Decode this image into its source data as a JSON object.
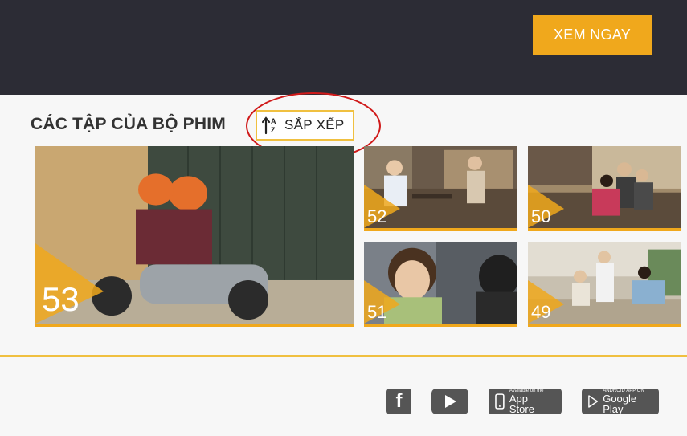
{
  "header": {
    "cta_label": "XEM NGAY"
  },
  "section": {
    "title": "CÁC TẬP CỦA BỘ PHIM",
    "sort_label": "SẮP XẾP",
    "sort_icon": "sort-a-z-icon"
  },
  "episodes": [
    {
      "number": "53"
    },
    {
      "number": "52"
    },
    {
      "number": "50"
    },
    {
      "number": "51"
    },
    {
      "number": "49"
    }
  ],
  "colors": {
    "accent": "#f0a81c",
    "topbar": "#2c2c35",
    "annotation": "#d01a1a"
  },
  "footer": {
    "facebook_glyph": "f",
    "appstore_small": "Available on the",
    "appstore_big": "App Store",
    "gplay_small": "ANDROID APP ON",
    "gplay_big": "Google Play"
  }
}
